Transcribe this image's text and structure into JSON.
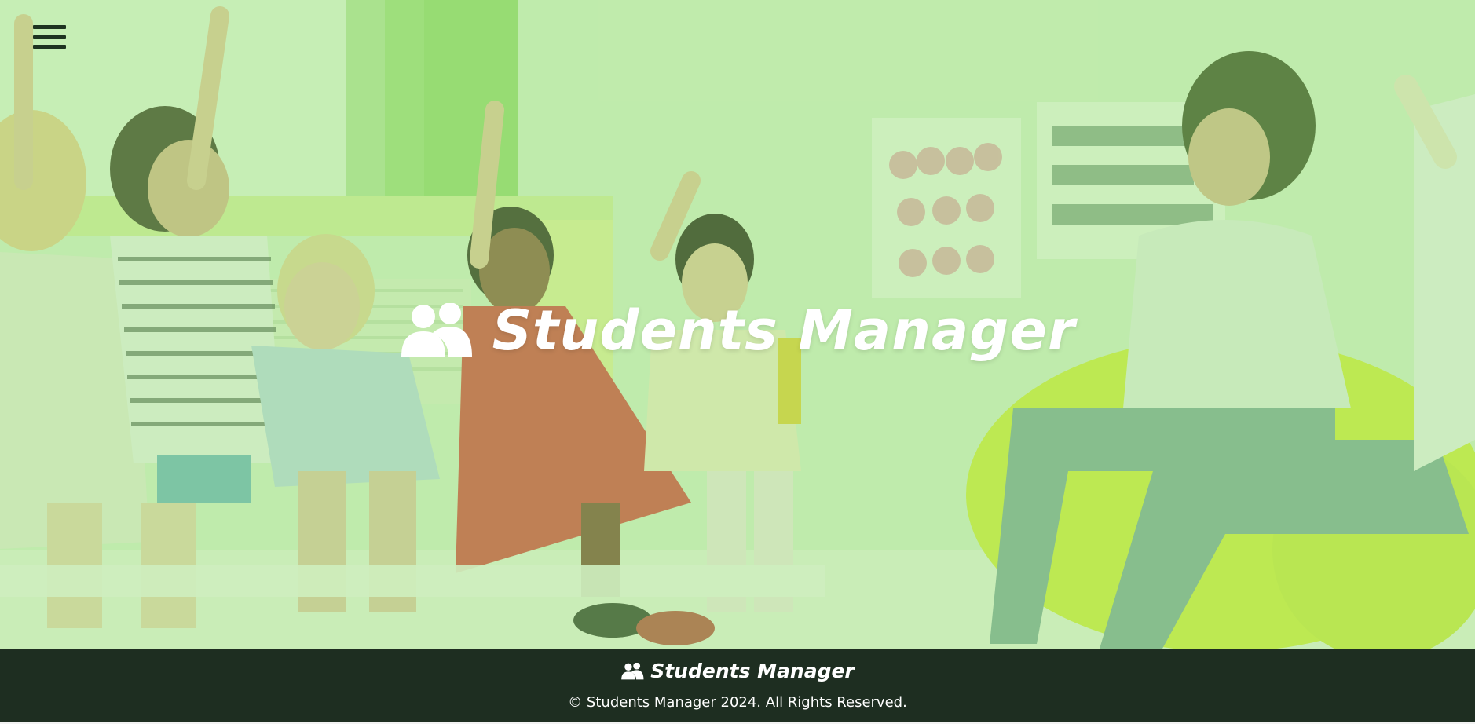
{
  "menu": {
    "icon": "hamburger-menu-icon"
  },
  "hero": {
    "title": "Students Manager",
    "icon": "users-icon",
    "overlay_color": "#96e278"
  },
  "footer": {
    "brand": "Students Manager",
    "icon": "users-icon",
    "copyright": "© Students Manager 2024. All Rights Reserved.",
    "background": "#1e2e21"
  }
}
